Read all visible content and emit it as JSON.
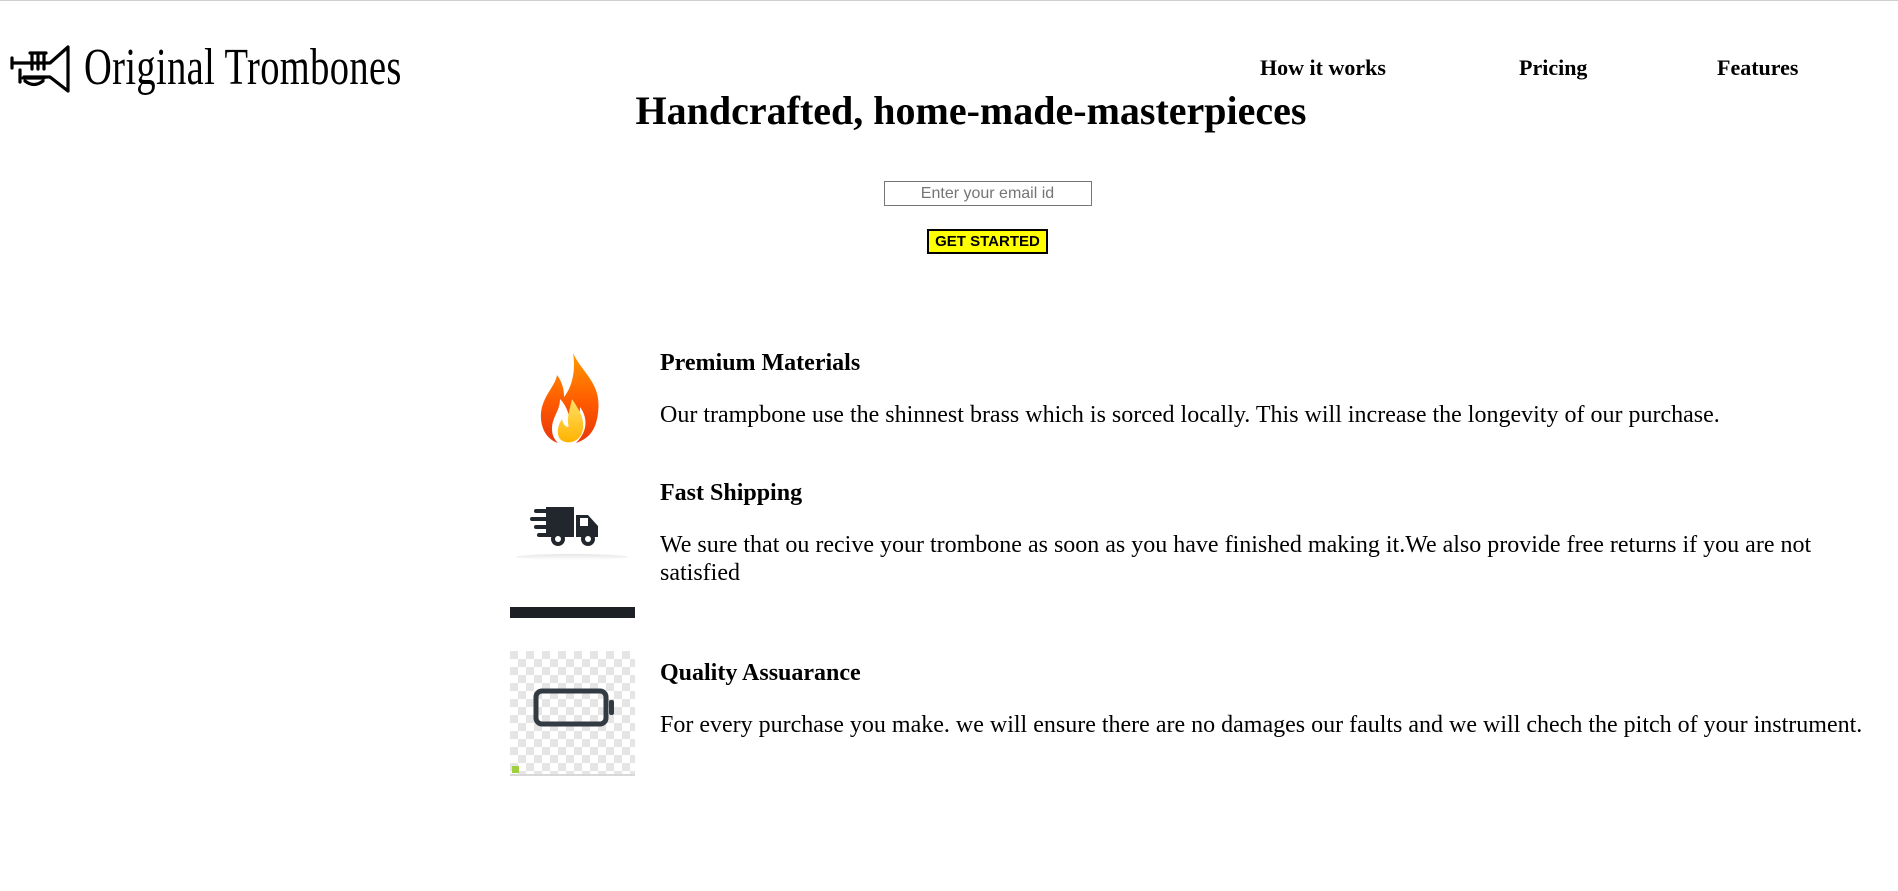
{
  "header": {
    "logo_text": "Original Trombones",
    "logo_icon": "trumpet-icon",
    "nav": [
      {
        "label": "How it works"
      },
      {
        "label": "Pricing"
      },
      {
        "label": "Features"
      }
    ]
  },
  "hero": {
    "title": "Handcrafted, home-made-masterpieces",
    "email_placeholder": "Enter your email id",
    "email_value": "",
    "button_label": "GET STARTED"
  },
  "features": [
    {
      "icon": "flame-icon",
      "title": "Premium Materials",
      "description": "Our trampbone use the shinnest brass which is sorced locally. This will increase the longevity of our purchase."
    },
    {
      "icon": "delivery-truck-icon",
      "title": "Fast Shipping",
      "description": "We sure that ou recive your trombone as soon as you have finished making it.We also provide free returns if you are not satisfied"
    },
    {
      "icon": "battery-icon",
      "title": "Quality Assuarance",
      "description": "For every purchase you make. we will ensure there are no damages our faults and we will chech the pitch of your instrument."
    }
  ],
  "colors": {
    "button_background": "#ffff00",
    "flame_outer": "#ff5a00",
    "flame_inner": "#ffc400",
    "truck": "#22272e"
  }
}
